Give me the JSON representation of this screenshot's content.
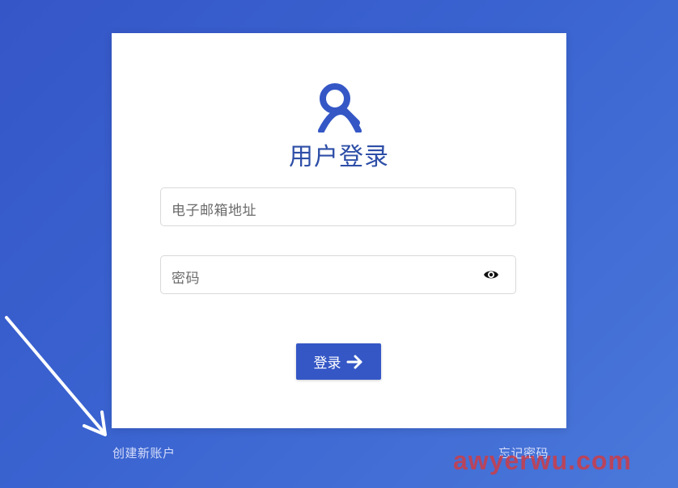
{
  "login": {
    "title": "用户登录",
    "email_placeholder": "电子邮箱地址",
    "password_placeholder": "密码",
    "submit_label": "登录"
  },
  "footer": {
    "create_account": "创建新账户",
    "forgot_password": "忘记密码"
  },
  "watermark": "awyerwu.com",
  "colors": {
    "accent": "#3557c6",
    "background": "#3a63d0",
    "title": "#2d4ea7",
    "link": "#d7defa",
    "watermark": "#cd3c46"
  },
  "icons": {
    "logo": "brand-loop-icon",
    "password_toggle": "eye-icon",
    "submit": "arrow-right-icon",
    "annotation": "annotation-arrow-icon"
  }
}
